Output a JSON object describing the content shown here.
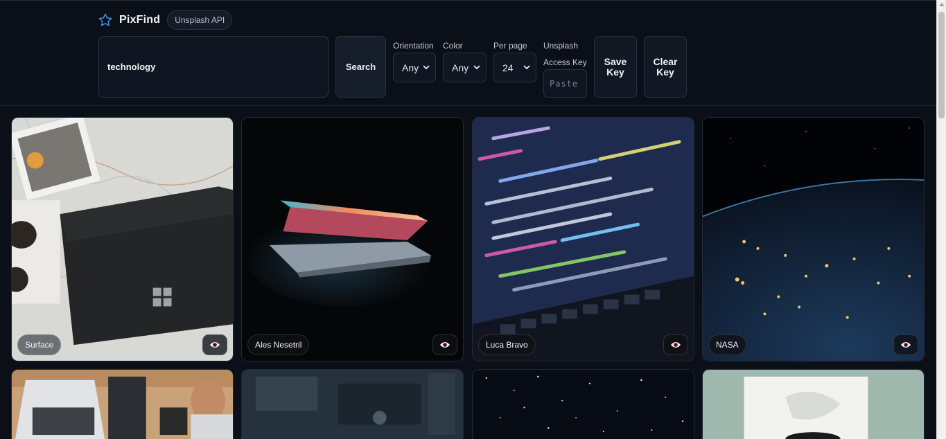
{
  "app": {
    "name": "PixFind",
    "badge": "Unsplash API"
  },
  "search": {
    "value": "technology",
    "button_label": "Search"
  },
  "filters": {
    "orientation_label": "Orientation",
    "orientation_value": "Any",
    "color_label": "Color",
    "color_value": "Any",
    "per_page_label": "Per page",
    "per_page_value": "24",
    "key_label_line1": "Unsplash",
    "key_label_line2": "Access Key",
    "key_placeholder": "Paste"
  },
  "buttons": {
    "save_key_line1": "Save",
    "save_key_line2": "Key",
    "clear_key_line1": "Clear",
    "clear_key_line2": "Key"
  },
  "photos": [
    {
      "credit": "Surface"
    },
    {
      "credit": "Ales Nesetril"
    },
    {
      "credit": "Luca Bravo"
    },
    {
      "credit": "NASA"
    }
  ],
  "icons": {
    "brand": "star-icon",
    "view": "eye-icon",
    "dropdown": "chevron-down-icon"
  },
  "colors": {
    "background": "#0b0f17",
    "panel": "#0f1521",
    "border": "#2a3140",
    "accent": "#3b82f6"
  }
}
